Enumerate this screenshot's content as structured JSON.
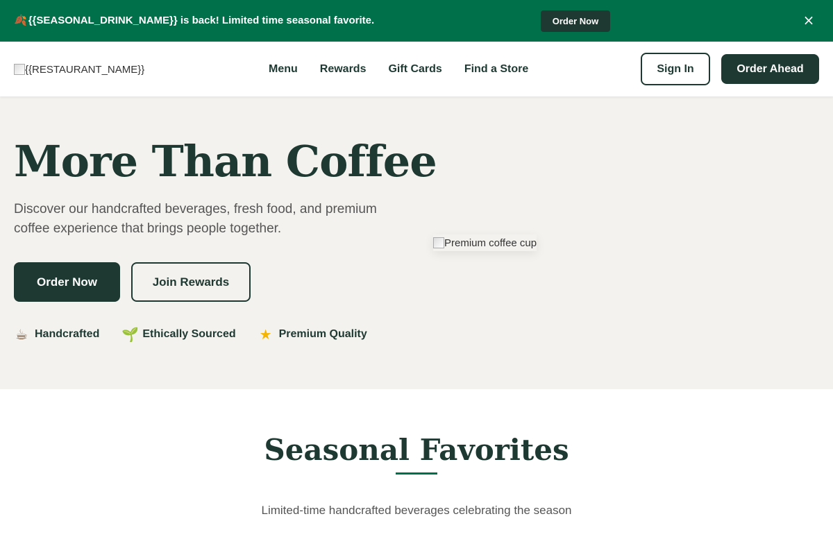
{
  "colors": {
    "primary_dark": "#1e3932",
    "accent_green": "#00704a",
    "hero_bg": "#f4f2ee"
  },
  "promo": {
    "icon": "leaf-icon",
    "text": "{{SEASONAL_DRINK_NAME}} is back! Limited time seasonal favorite.",
    "button": "Order Now",
    "close": "×"
  },
  "header": {
    "logo_alt": "{{RESTAURANT_NAME}}",
    "nav": [
      "Menu",
      "Rewards",
      "Gift Cards",
      "Find a Store"
    ],
    "sign_in": "Sign In",
    "order_ahead": "Order Ahead"
  },
  "hero": {
    "title": "More Than Coffee",
    "subtitle": "Discover our handcrafted beverages, fresh food, and premium coffee experience that brings people together.",
    "primary_button": "Order Now",
    "secondary_button": "Join Rewards",
    "features": [
      {
        "icon": "coffee-cup-icon",
        "label": "Handcrafted"
      },
      {
        "icon": "seedling-icon",
        "label": "Ethically Sourced"
      },
      {
        "icon": "star-icon",
        "label": "Premium Quality"
      }
    ],
    "image_alt": "Premium coffee cup"
  },
  "seasonal": {
    "title": "Seasonal Favorites",
    "subtitle": "Limited-time handcrafted beverages celebrating the season"
  }
}
